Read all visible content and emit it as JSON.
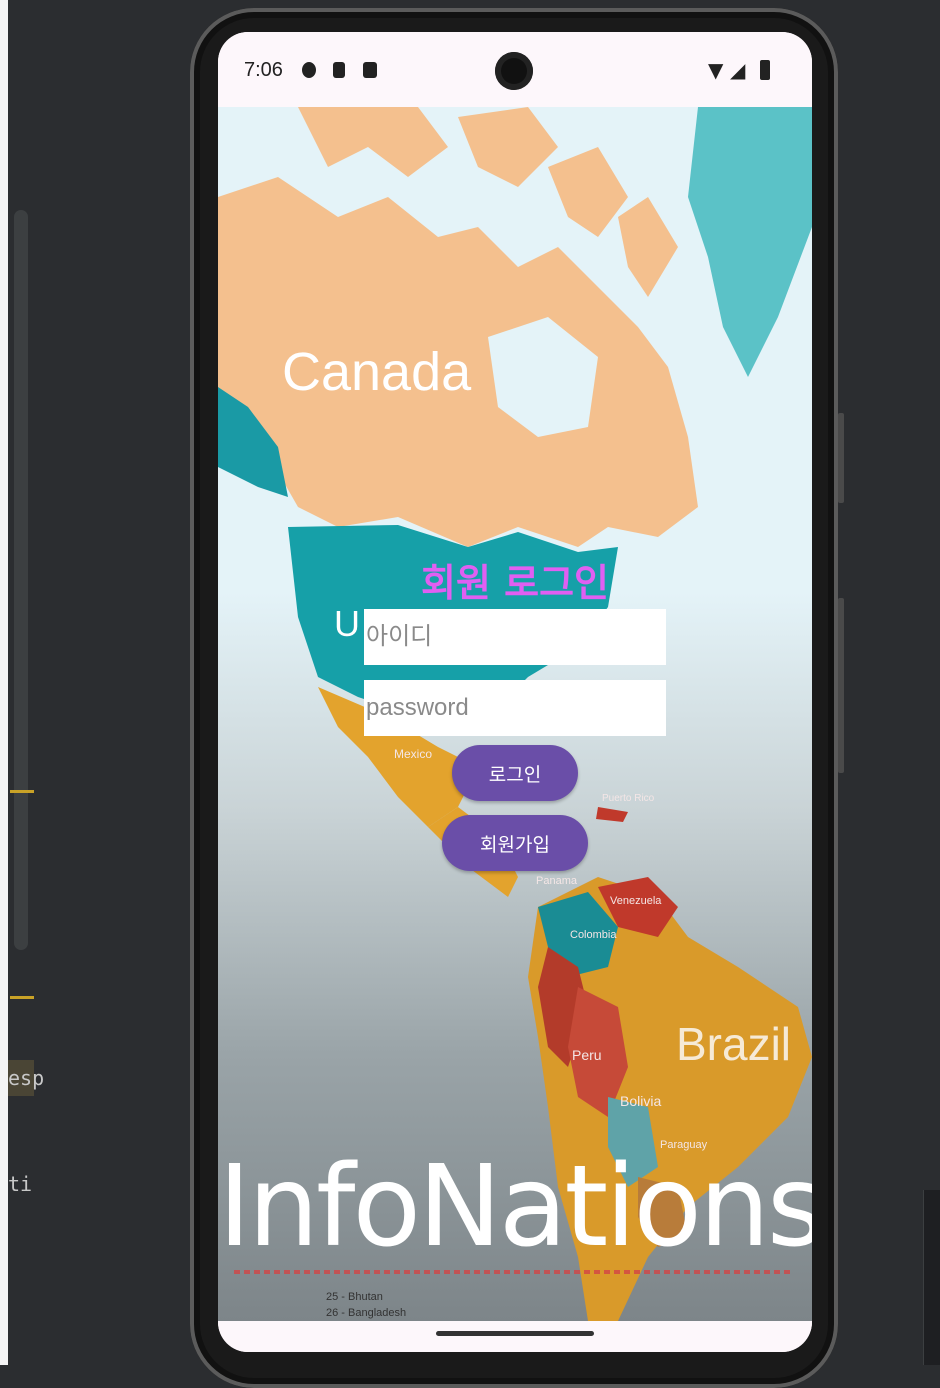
{
  "ide": {
    "snippet_1": "esp",
    "snippet_2": "ti"
  },
  "status_bar": {
    "time": "7:06"
  },
  "map_labels": {
    "canada": "Canada",
    "us_partial": "U",
    "mexico": "Mexico",
    "puerto_rico": "Puerto Rico",
    "panama": "Panama",
    "venezuela": "Venezuela",
    "colombia": "Colombia",
    "brazil": "Brazil",
    "peru": "Peru",
    "bolivia": "Bolivia",
    "paraguay": "Paraguay",
    "bhutan": "25 - Bhutan",
    "bangladesh": "26 - Bangladesh"
  },
  "login": {
    "title": "회원 로그인",
    "id_placeholder": "아이디",
    "password_placeholder": "password",
    "login_button": "로그인",
    "signup_button": "회원가입"
  },
  "brand": "InfoNations",
  "colors": {
    "title": "#e05ff2",
    "button": "#6a4ea8"
  }
}
